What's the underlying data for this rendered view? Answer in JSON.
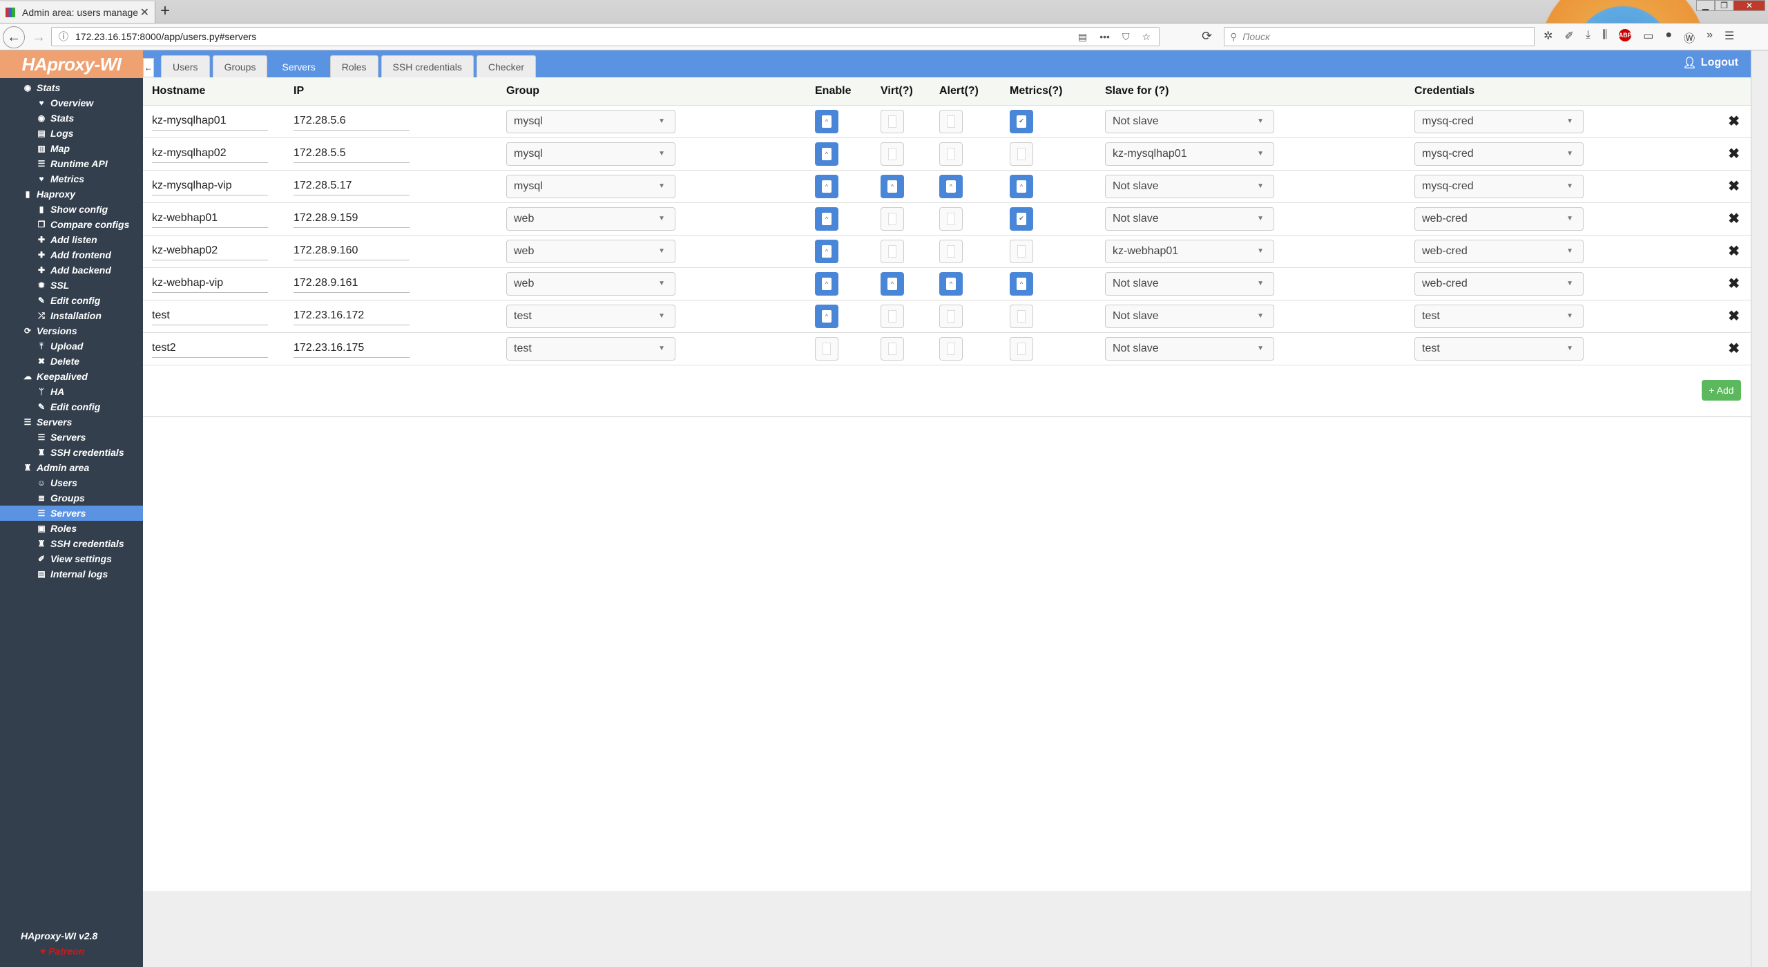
{
  "browser": {
    "tab_title": "Admin area: users manage - HA",
    "url": "172.23.16.157:8000/app/users.py#servers",
    "search_placeholder": "Поиск",
    "ext_icons": [
      "gear-icon",
      "wrench-icon",
      "download-icon",
      "library-icon",
      "abp-icon",
      "sidebar-icon",
      "extension-icon",
      "wot-icon",
      "overflow-icon",
      "hamburger-icon"
    ],
    "abp_label": "ABP"
  },
  "app": {
    "logo": "HAproxy-WI",
    "version": "HAproxy-WI v2.8",
    "patreon": "Patreon",
    "logout": "Logout",
    "accent": "#5b93e3"
  },
  "sidebar": [
    {
      "label": "Stats",
      "level": 1,
      "icon": "eye-icon",
      "glyph": "◉"
    },
    {
      "label": "Overview",
      "level": 2,
      "icon": "heartbeat-icon",
      "glyph": "♥"
    },
    {
      "label": "Stats",
      "level": 2,
      "icon": "eye-icon",
      "glyph": "◉"
    },
    {
      "label": "Logs",
      "level": 2,
      "icon": "book-icon",
      "glyph": "▤"
    },
    {
      "label": "Map",
      "level": 2,
      "icon": "map-icon",
      "glyph": "▥"
    },
    {
      "label": "Runtime API",
      "level": 2,
      "icon": "server-icon",
      "glyph": "☰"
    },
    {
      "label": "Metrics",
      "level": 2,
      "icon": "heartbeat-icon",
      "glyph": "♥"
    },
    {
      "label": "Haproxy",
      "level": 1,
      "icon": "file-icon",
      "glyph": "▮"
    },
    {
      "label": "Show config",
      "level": 2,
      "icon": "file-icon",
      "glyph": "▮"
    },
    {
      "label": "Compare configs",
      "level": 2,
      "icon": "copy-icon",
      "glyph": "❐"
    },
    {
      "label": "Add listen",
      "level": 2,
      "icon": "plus-icon",
      "glyph": "✚"
    },
    {
      "label": "Add frontend",
      "level": 2,
      "icon": "plus-icon",
      "glyph": "✚"
    },
    {
      "label": "Add backend",
      "level": 2,
      "icon": "plus-icon",
      "glyph": "✚"
    },
    {
      "label": "SSL",
      "level": 2,
      "icon": "certificate-icon",
      "glyph": "✹"
    },
    {
      "label": "Edit config",
      "level": 2,
      "icon": "edit-icon",
      "glyph": "✎"
    },
    {
      "label": "Installation",
      "level": 2,
      "icon": "shuffle-icon",
      "glyph": "⤮"
    },
    {
      "label": "Versions",
      "level": 1,
      "icon": "sync-icon",
      "glyph": "⟳"
    },
    {
      "label": "Upload",
      "level": 2,
      "icon": "upload-icon",
      "glyph": "⤒"
    },
    {
      "label": "Delete",
      "level": 2,
      "icon": "times-icon",
      "glyph": "✖"
    },
    {
      "label": "Keepalived",
      "level": 1,
      "icon": "cloud-icon",
      "glyph": "☁"
    },
    {
      "label": "HA",
      "level": 2,
      "icon": "branch-icon",
      "glyph": "ᛘ"
    },
    {
      "label": "Edit config",
      "level": 2,
      "icon": "edit-icon",
      "glyph": "✎"
    },
    {
      "label": "Servers",
      "level": 1,
      "icon": "server-icon",
      "glyph": "☰"
    },
    {
      "label": "Servers",
      "level": 2,
      "icon": "server-icon",
      "glyph": "☰"
    },
    {
      "label": "SSH credentials",
      "level": 2,
      "icon": "user-secret-icon",
      "glyph": "♜"
    },
    {
      "label": "Admin area",
      "level": 1,
      "icon": "user-secret-icon",
      "glyph": "♜"
    },
    {
      "label": "Users",
      "level": 2,
      "icon": "user-plus-icon",
      "glyph": "☺"
    },
    {
      "label": "Groups",
      "level": 2,
      "icon": "list-icon",
      "glyph": "≣"
    },
    {
      "label": "Servers",
      "level": 2,
      "icon": "server-icon",
      "glyph": "☰",
      "active": true
    },
    {
      "label": "Roles",
      "level": 2,
      "icon": "id-card-icon",
      "glyph": "▣"
    },
    {
      "label": "SSH credentials",
      "level": 2,
      "icon": "user-secret-icon",
      "glyph": "♜"
    },
    {
      "label": "View settings",
      "level": 2,
      "icon": "wrench-icon",
      "glyph": "✐"
    },
    {
      "label": "Internal logs",
      "level": 2,
      "icon": "book-icon",
      "glyph": "▤"
    }
  ],
  "tabs": [
    {
      "label": "Users"
    },
    {
      "label": "Groups"
    },
    {
      "label": "Servers",
      "active": true
    },
    {
      "label": "Roles"
    },
    {
      "label": "SSH credentials"
    },
    {
      "label": "Checker"
    }
  ],
  "table": {
    "headers": {
      "hostname": "Hostname",
      "ip": "IP",
      "group": "Group",
      "enable": "Enable",
      "virt": "Virt(?)",
      "alert": "Alert(?)",
      "metrics": "Metrics(?)",
      "slave": "Slave for (?)",
      "cred": "Credentials"
    },
    "rows": [
      {
        "hostname": "kz-mysqlhap01",
        "ip": "172.28.5.6",
        "group": "mysql",
        "enable": true,
        "virt": false,
        "alert": false,
        "metrics": true,
        "metrics_check": true,
        "slave": "Not slave",
        "cred": "mysq-cred"
      },
      {
        "hostname": "kz-mysqlhap02",
        "ip": "172.28.5.5",
        "group": "mysql",
        "enable": true,
        "virt": false,
        "alert": false,
        "metrics": false,
        "slave": "kz-mysqlhap01",
        "cred": "mysq-cred"
      },
      {
        "hostname": "kz-mysqlhap-vip",
        "ip": "172.28.5.17",
        "group": "mysql",
        "enable": true,
        "virt": true,
        "alert": true,
        "metrics": true,
        "slave": "Not slave",
        "cred": "mysq-cred"
      },
      {
        "hostname": "kz-webhap01",
        "ip": "172.28.9.159",
        "group": "web",
        "enable": true,
        "virt": false,
        "alert": false,
        "metrics": true,
        "metrics_check": true,
        "slave": "Not slave",
        "cred": "web-cred"
      },
      {
        "hostname": "kz-webhap02",
        "ip": "172.28.9.160",
        "group": "web",
        "enable": true,
        "virt": false,
        "alert": false,
        "metrics": false,
        "slave": "kz-webhap01",
        "cred": "web-cred"
      },
      {
        "hostname": "kz-webhap-vip",
        "ip": "172.28.9.161",
        "group": "web",
        "enable": true,
        "virt": true,
        "alert": true,
        "metrics": true,
        "slave": "Not slave",
        "cred": "web-cred"
      },
      {
        "hostname": "test",
        "ip": "172.23.16.172",
        "group": "test",
        "enable": true,
        "virt": false,
        "alert": false,
        "metrics": false,
        "slave": "Not slave",
        "cred": "test"
      },
      {
        "hostname": "test2",
        "ip": "172.23.16.175",
        "group": "test",
        "enable": false,
        "virt": false,
        "alert": false,
        "metrics": false,
        "slave": "Not slave",
        "cred": "test"
      }
    ],
    "add_label": "+ Add"
  }
}
